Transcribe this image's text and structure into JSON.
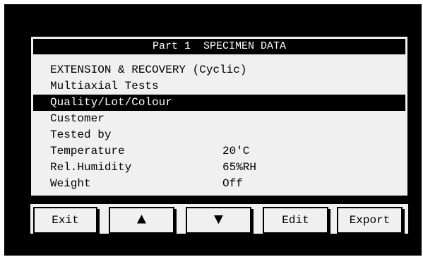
{
  "panel": {
    "title": "Part 1  SPECIMEN DATA",
    "rows": [
      {
        "label": "EXTENSION & RECOVERY (Cyclic)",
        "value": ""
      },
      {
        "label": "Multiaxial Tests",
        "value": ""
      },
      {
        "label": "Quality/Lot/Colour",
        "value": "",
        "selected": true
      },
      {
        "label": "Customer",
        "value": ""
      },
      {
        "label": "Tested by",
        "value": ""
      },
      {
        "label": "Temperature",
        "value": "20'C"
      },
      {
        "label": "Rel.Humidity",
        "value": "65%RH"
      },
      {
        "label": "Weight",
        "value": "Off"
      }
    ]
  },
  "buttons": {
    "exit": "Exit",
    "up": "▲",
    "down": "▼",
    "edit": "Edit",
    "export": "Export"
  },
  "icons": {
    "up": "up-arrow-icon",
    "down": "down-arrow-icon"
  },
  "colors": {
    "background": "#000000",
    "panel": "#f0f0f0",
    "highlight": "#000000",
    "highlight_text": "#ffffff"
  }
}
